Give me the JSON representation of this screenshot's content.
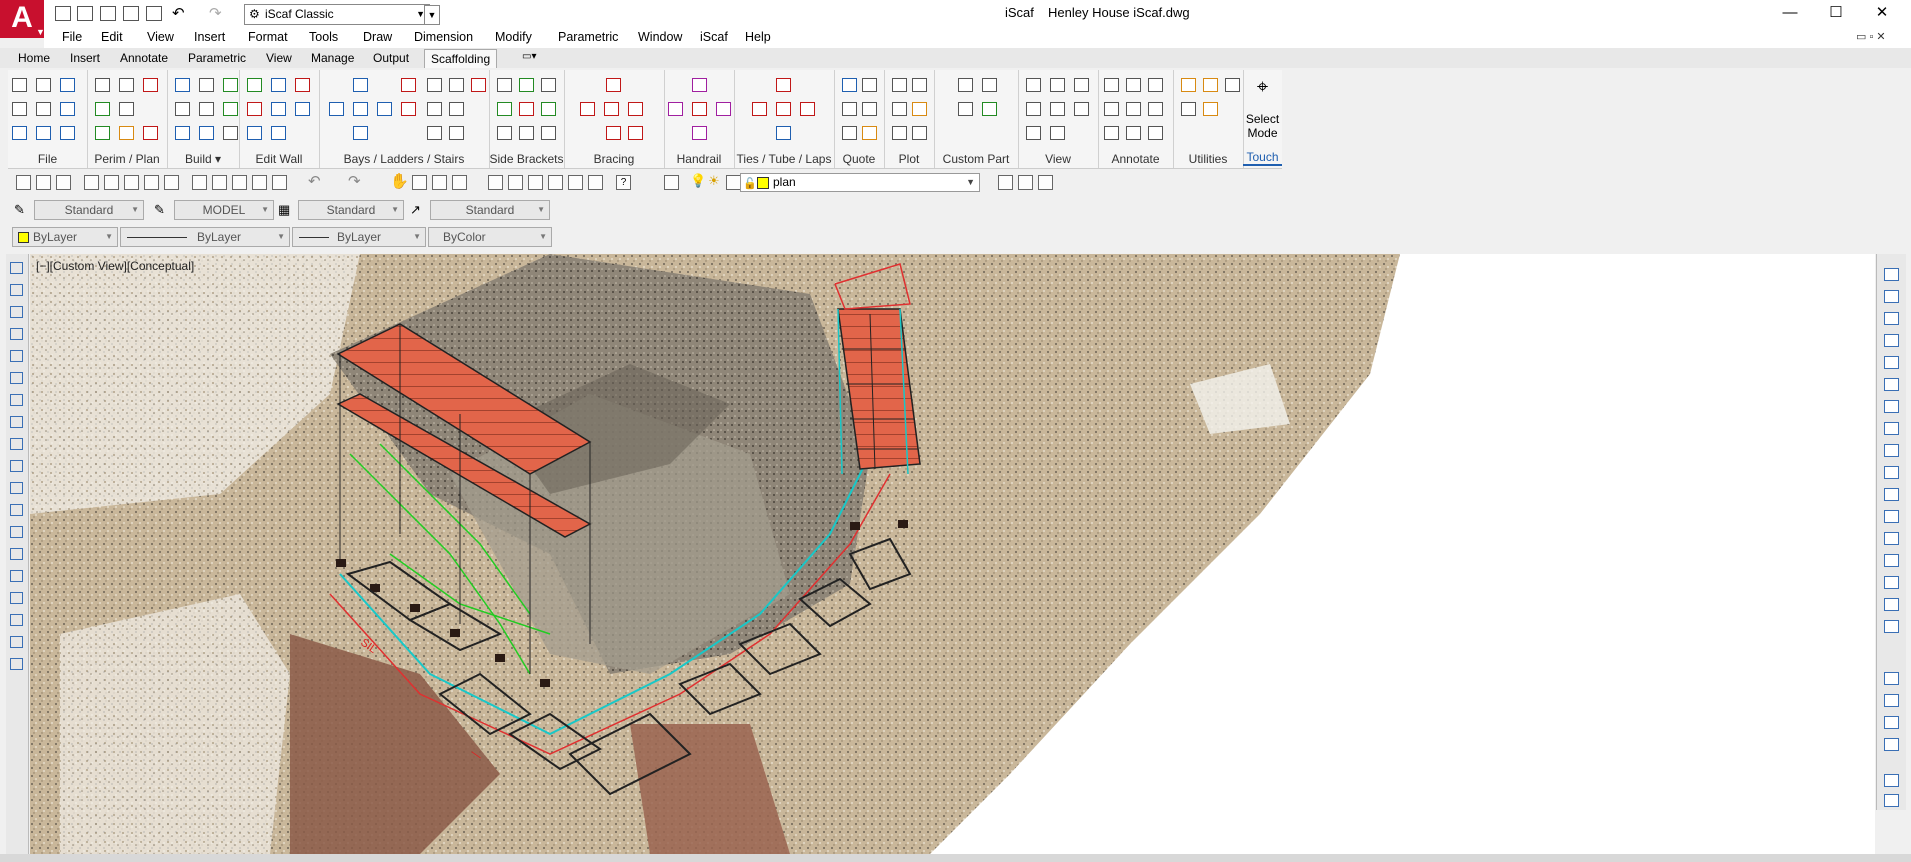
{
  "window": {
    "app_title": "iScaf",
    "file_title": "Henley House iScaf.dwg",
    "workspace": "iScaf Classic",
    "minimize": "—",
    "maximize": "☐",
    "close": "✕"
  },
  "menubar": {
    "items": [
      "File",
      "Edit",
      "View",
      "Insert",
      "Format",
      "Tools",
      "Draw",
      "Dimension",
      "Modify",
      "Parametric",
      "Window",
      "iScaf",
      "Help"
    ]
  },
  "ribbon_tabs": {
    "items": [
      "Home",
      "Insert",
      "Annotate",
      "Parametric",
      "View",
      "Manage",
      "Output",
      "Scaffolding"
    ],
    "active": "Scaffolding"
  },
  "ribbon_groups": {
    "labels": [
      "File",
      "Perim / Plan",
      "Build ▾",
      "Edit Wall",
      "Bays / Ladders / Stairs",
      "Side Brackets",
      "Bracing",
      "Handrail",
      "Ties / Tube / Laps",
      "Quote",
      "Plot",
      "Custom Part",
      "View",
      "Annotate",
      "Utilities",
      "Touch"
    ],
    "select_mode": "Select Mode"
  },
  "toolbar": {
    "layer": "plan"
  },
  "styles": {
    "text_style": "Standard",
    "dim_style": "MODEL",
    "table_style": "Standard",
    "multileader_style": "Standard"
  },
  "properties": {
    "color": "ByLayer",
    "linetype": "ByLayer",
    "lineweight": "ByLayer",
    "plot_style": "ByColor"
  },
  "viewport": {
    "label": "[−][Custom View][Conceptual]"
  },
  "colors": {
    "accent_red": "#c8102e",
    "scaffold_board": "#e2654a",
    "layer_yellow": "#ffff00"
  }
}
